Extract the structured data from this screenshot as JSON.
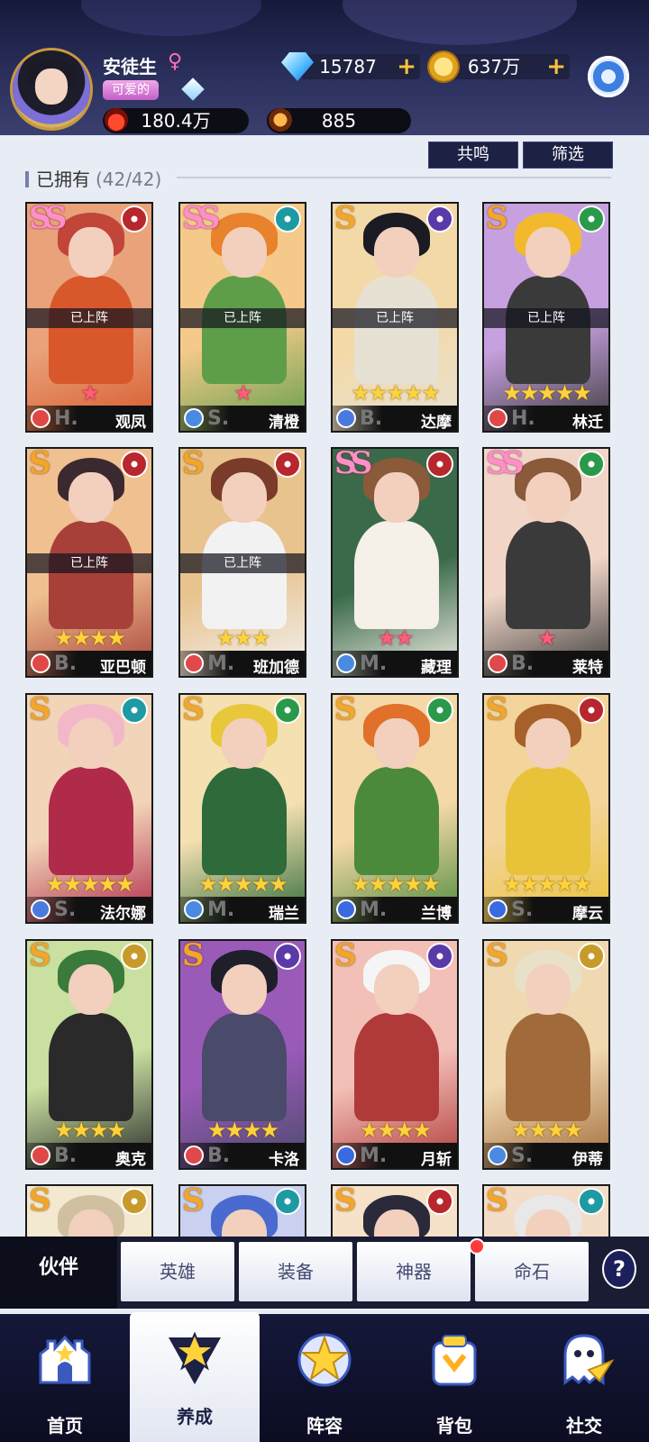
{
  "player": {
    "name": "安徒生",
    "gender_symbol": "♀",
    "title": "可爱的",
    "power": "180.4万",
    "star_currency": "885"
  },
  "currencies": {
    "gems": "15787",
    "gold": "637万",
    "plus": "+"
  },
  "actions": {
    "resonance": "共鸣",
    "filter": "筛选"
  },
  "section": {
    "label": "已拥有",
    "count": "(42/42)"
  },
  "deployed_label": "已上阵",
  "heroes": [
    {
      "name": "观凤",
      "grade": "SS",
      "element": "fire",
      "role": "H.",
      "stars": 1,
      "star_color": "red",
      "deployed": true,
      "cls": "tank",
      "palette": [
        "#e9a27a",
        "#c2453a",
        "#d8582b"
      ]
    },
    {
      "name": "清橙",
      "grade": "SS",
      "element": "water",
      "role": "S.",
      "stars": 1,
      "star_color": "red",
      "deployed": true,
      "cls": "heal",
      "palette": [
        "#f4c98a",
        "#e8822c",
        "#5e9e4a"
      ]
    },
    {
      "name": "达摩",
      "grade": "S",
      "element": "dark",
      "role": "B.",
      "stars": 5,
      "star_color": "gold",
      "deployed": true,
      "cls": "mage",
      "palette": [
        "#f3d9a8",
        "#1b1b24",
        "#e7e1d3"
      ]
    },
    {
      "name": "林迁",
      "grade": "S",
      "element": "wind",
      "role": "H.",
      "stars": 5,
      "star_color": "gold",
      "deployed": true,
      "cls": "tank",
      "palette": [
        "#c7a0e0",
        "#f3b92d",
        "#3a3a3a"
      ]
    },
    {
      "name": "亚巴顿",
      "grade": "S",
      "element": "fire",
      "role": "B.",
      "stars": 4,
      "star_color": "gold",
      "deployed": true,
      "cls": "tank",
      "palette": [
        "#f0c090",
        "#3a2a30",
        "#a8403a"
      ]
    },
    {
      "name": "班加德",
      "grade": "S",
      "element": "fire",
      "role": "M.",
      "stars": 3,
      "star_color": "gold",
      "deployed": true,
      "cls": "dps",
      "palette": [
        "#e8c38e",
        "#7a3b2a",
        "#f2f2f2"
      ]
    },
    {
      "name": "藏理",
      "grade": "SS",
      "element": "fire",
      "role": "M.",
      "stars": 2,
      "star_color": "red",
      "deployed": false,
      "cls": "heal",
      "palette": [
        "#3a6a4a",
        "#8a5a3a",
        "#f5f0e8"
      ]
    },
    {
      "name": "莱特",
      "grade": "SS",
      "element": "wind",
      "role": "B.",
      "stars": 1,
      "star_color": "red",
      "deployed": false,
      "cls": "dps",
      "palette": [
        "#f1d6c8",
        "#8a5a3a",
        "#3a3a3a"
      ]
    },
    {
      "name": "法尔娜",
      "grade": "S",
      "element": "water",
      "role": "S.",
      "stars": 5,
      "star_color": "gold",
      "deployed": false,
      "cls": "mage",
      "palette": [
        "#f2d4b8",
        "#f2b8c8",
        "#b02a4a"
      ]
    },
    {
      "name": "瑞兰",
      "grade": "S",
      "element": "wind",
      "role": "M.",
      "stars": 5,
      "star_color": "gold",
      "deployed": false,
      "cls": "heal",
      "palette": [
        "#f4e0b0",
        "#e8c83a",
        "#2e6a3a"
      ]
    },
    {
      "name": "兰博",
      "grade": "S",
      "element": "wind",
      "role": "M.",
      "stars": 5,
      "star_color": "gold",
      "deployed": false,
      "cls": "sword",
      "palette": [
        "#f5d8a8",
        "#e0702a",
        "#4a8a3a"
      ]
    },
    {
      "name": "摩云",
      "grade": "S",
      "element": "fire",
      "role": "S.",
      "stars": 5,
      "star_color": "gold",
      "deployed": false,
      "cls": "sword",
      "palette": [
        "#f3d49a",
        "#a8602a",
        "#e8c33a"
      ]
    },
    {
      "name": "奥克",
      "grade": "S",
      "element": "light",
      "role": "B.",
      "stars": 4,
      "star_color": "gold",
      "deployed": false,
      "cls": "tank",
      "palette": [
        "#c9e0a0",
        "#3a7a3a",
        "#2a2a2a"
      ]
    },
    {
      "name": "卡洛",
      "grade": "S",
      "element": "dark",
      "role": "B.",
      "stars": 4,
      "star_color": "gold",
      "deployed": false,
      "cls": "fire",
      "palette": [
        "#9a5ab8",
        "#1f1f2a",
        "#4a4a6a"
      ]
    },
    {
      "name": "月斩",
      "grade": "S",
      "element": "dark",
      "role": "M.",
      "stars": 4,
      "star_color": "gold",
      "deployed": false,
      "cls": "sword",
      "palette": [
        "#f3c0b8",
        "#f5f5f5",
        "#b03a3a"
      ]
    },
    {
      "name": "伊蒂",
      "grade": "S",
      "element": "light",
      "role": "S.",
      "stars": 4,
      "star_color": "gold",
      "deployed": false,
      "cls": "heal",
      "palette": [
        "#f0d8b0",
        "#e8e0c8",
        "#a06a3a"
      ]
    },
    {
      "name": "",
      "grade": "S",
      "element": "light",
      "role": "",
      "stars": 0,
      "star_color": "gold",
      "deployed": false,
      "cls": "tank",
      "palette": [
        "#f3e8d0",
        "#d0c0a0",
        "#8a7a5a"
      ]
    },
    {
      "name": "",
      "grade": "S",
      "element": "water",
      "role": "",
      "stars": 0,
      "star_color": "gold",
      "deployed": false,
      "cls": "heal",
      "palette": [
        "#c9d0f0",
        "#4a6ad0",
        "#f0f0f0"
      ]
    },
    {
      "name": "",
      "grade": "S",
      "element": "fire",
      "role": "",
      "stars": 0,
      "star_color": "gold",
      "deployed": false,
      "cls": "heal",
      "palette": [
        "#f6e2c8",
        "#2a2a3a",
        "#f0c0c8"
      ]
    },
    {
      "name": "",
      "grade": "S",
      "element": "water",
      "role": "",
      "stars": 0,
      "star_color": "gold",
      "deployed": false,
      "cls": "heal",
      "palette": [
        "#f3dcc8",
        "#e8e8e8",
        "#c8a0d0"
      ]
    }
  ],
  "element_colors": {
    "fire": "#b8262e",
    "water": "#1e9aa3",
    "dark": "#5a3aa8",
    "wind": "#2a9a4a",
    "light": "#c89a2a"
  },
  "class_colors": {
    "tank": "#e04848",
    "heal": "#4a8ae0",
    "mage": "#4a7ae0",
    "dps": "#e0484a",
    "sword": "#3a6ae0",
    "fire": "#e0484a"
  },
  "subtabs": [
    "伙伴",
    "英雄",
    "装备",
    "神器",
    "命石"
  ],
  "help_label": "?",
  "nav": [
    {
      "label": "首页",
      "icon": "castle-icon"
    },
    {
      "label": "养成",
      "icon": "star-triangle-icon"
    },
    {
      "label": "阵容",
      "icon": "formation-star-icon"
    },
    {
      "label": "背包",
      "icon": "backpack-icon"
    },
    {
      "label": "社交",
      "icon": "ghost-chat-icon"
    }
  ]
}
